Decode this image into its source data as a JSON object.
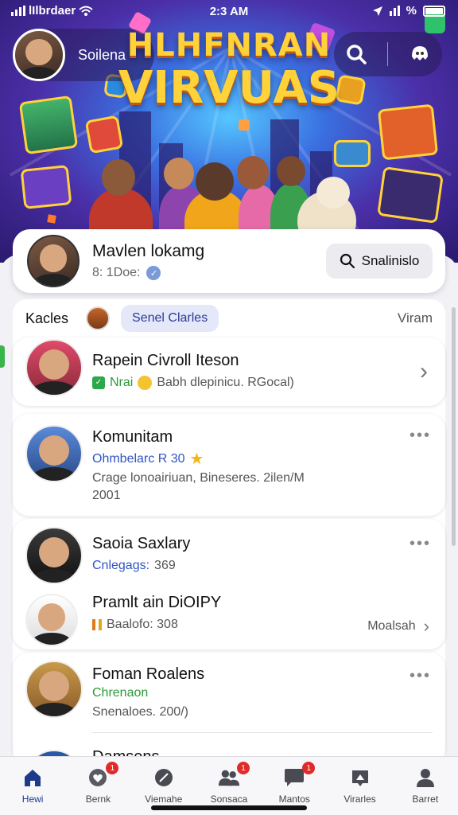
{
  "status_bar": {
    "carrier": "lIlbrdaer",
    "time": "2:3 AM",
    "battery_text": "%"
  },
  "header": {
    "profile_name": "Soilena",
    "title_line1": "HLHFNRAN",
    "title_line2": "VIRVUAS",
    "icons": [
      "search-icon",
      "ghost-icon"
    ]
  },
  "featured": {
    "title": "Mavlen lokamg",
    "subtitle": "8: 1Doe:",
    "search_label": "Snalinislo"
  },
  "list_header": {
    "title": "Kacles",
    "chip": "Senel Clarles",
    "right": "Viram"
  },
  "rows": [
    {
      "title": "Rapein Civroll Iteson",
      "badge_text": "Nrai",
      "sub": "Babh dlepinicu. RGocal)"
    },
    {
      "title": "Komunitam",
      "sub_accent": "Ohmbelarc R 30",
      "meta": "Crage lonoairiuan, Bineseres. 2ilen/M 2001"
    },
    {
      "title": "Saoia Saxlary",
      "sub_accent": "Cnlegags:",
      "sub_value": "369"
    },
    {
      "title": "Pramlt ain DiOIPY",
      "sub": "Baalofo: 308",
      "right": "Moalsah"
    },
    {
      "title": "Foman Roalens",
      "sub_green": "Chrenaon",
      "meta": "Snenaloes. 200/)"
    },
    {
      "title": "Damsens"
    }
  ],
  "tabs": [
    {
      "label": "Hewi",
      "icon": "home-icon",
      "badge": ""
    },
    {
      "label": "Bernk",
      "icon": "heart-icon",
      "badge": "1"
    },
    {
      "label": "Viemahe",
      "icon": "pen-icon",
      "badge": ""
    },
    {
      "label": "Sonsaca",
      "icon": "group-icon",
      "badge": "1"
    },
    {
      "label": "Mantos",
      "icon": "chat-icon",
      "badge": "1"
    },
    {
      "label": "Virarles",
      "icon": "flag-icon",
      "badge": ""
    },
    {
      "label": "Barret",
      "icon": "person-icon",
      "badge": ""
    }
  ],
  "colors": {
    "accent": "#2e55c4",
    "badge": "#e02a2a",
    "title_gold": "#ffd23a"
  }
}
